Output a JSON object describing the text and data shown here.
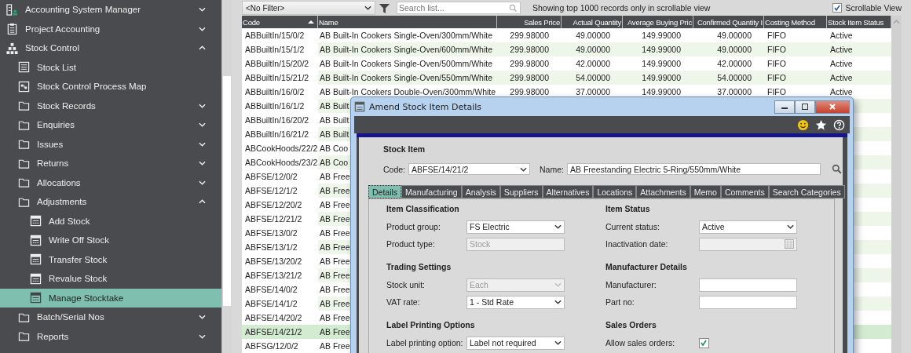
{
  "sidebar": {
    "items": [
      {
        "label": "Accounting System Manager",
        "kind": "users",
        "expanded": false
      },
      {
        "label": "Project Accounting",
        "kind": "clipboard",
        "expanded": false
      },
      {
        "label": "Stock Control",
        "kind": "sitemap",
        "expanded": true,
        "children": [
          {
            "label": "Stock List",
            "kind": "list"
          },
          {
            "label": "Stock Control Process Map",
            "kind": "process-map"
          },
          {
            "label": "Stock Records",
            "kind": "folder",
            "expanded": false
          },
          {
            "label": "Enquiries",
            "kind": "folder",
            "expanded": false
          },
          {
            "label": "Issues",
            "kind": "folder",
            "expanded": false
          },
          {
            "label": "Returns",
            "kind": "folder",
            "expanded": false
          },
          {
            "label": "Allocations",
            "kind": "folder",
            "expanded": false
          },
          {
            "label": "Adjustments",
            "kind": "folder",
            "expanded": true,
            "children": [
              {
                "label": "Add Stock",
                "kind": "form",
                "selected": false
              },
              {
                "label": "Write Off Stock",
                "kind": "form",
                "selected": false
              },
              {
                "label": "Transfer Stock",
                "kind": "form",
                "selected": false
              },
              {
                "label": "Revalue Stock",
                "kind": "form",
                "selected": false
              },
              {
                "label": "Manage Stocktake",
                "kind": "form",
                "selected": true
              }
            ]
          },
          {
            "label": "Batch/Serial Nos",
            "kind": "folder",
            "expanded": false
          },
          {
            "label": "Reports",
            "kind": "folder",
            "expanded": false
          }
        ]
      }
    ]
  },
  "toolbar": {
    "filter": "<No Filter>",
    "search": {
      "placeholder": "Search list..."
    },
    "notice": "Showing top 1000 records only in scrollable view",
    "scrollable_view": {
      "label": "Scrollable View",
      "checked": true
    }
  },
  "table": {
    "columns": [
      {
        "label": "Code",
        "sorted": true
      },
      {
        "label": "Name",
        "sorted": false
      },
      {
        "label": "Sales Price",
        "sorted": false
      },
      {
        "label": "Actual Quantity",
        "sorted": false
      },
      {
        "label": "Average Buying Pric",
        "sorted": false
      },
      {
        "label": "Confirmed Quantity I",
        "sorted": false
      },
      {
        "label": "Costing Method",
        "sorted": false
      },
      {
        "label": "Stock Item Status",
        "sorted": false
      }
    ],
    "rows": [
      {
        "selected": false,
        "cells": [
          "ABBuiltIn/15/0/2",
          "AB Built-In Cookers Single-Oven/300mm/White",
          "299.98000",
          "49.00000",
          "149.99000",
          "49.00000",
          "FIFO",
          "Active"
        ]
      },
      {
        "selected": false,
        "cells": [
          "ABBuiltIn/15/1/2",
          "AB Built-In Cookers Single-Oven/600mm/White",
          "299.98000",
          "49.00000",
          "149.99000",
          "49.00000",
          "FIFO",
          "Active"
        ]
      },
      {
        "selected": false,
        "cells": [
          "ABBuiltIn/15/20/2",
          "AB Built-In Cookers Single-Oven/500mm/White",
          "299.98000",
          "42.00000",
          "149.99000",
          "42.00000",
          "FIFO",
          "Active"
        ]
      },
      {
        "selected": false,
        "cells": [
          "ABBuiltIn/15/21/2",
          "AB Built-In Cookers Single-Oven/550mm/White",
          "299.98000",
          "54.00000",
          "149.99000",
          "54.00000",
          "FIFO",
          "Active"
        ]
      },
      {
        "selected": false,
        "cells": [
          "ABBuiltIn/16/0/2",
          "AB Built-In Cookers Double-Oven/300mm/White",
          "299.98000",
          "37.00000",
          "149.99000",
          "37.00000",
          "FIFO",
          "Active"
        ]
      },
      {
        "selected": false,
        "cells": [
          "ABBuiltIn/16/1/2",
          "AB Built"
        ]
      },
      {
        "selected": false,
        "cells": [
          "ABBuiltIn/16/20/2",
          "AB Built"
        ]
      },
      {
        "selected": false,
        "cells": [
          "ABBuiltIn/16/21/2",
          "AB Built"
        ]
      },
      {
        "selected": false,
        "cells": [
          "ABCookHoods/22/2",
          "AB Coo"
        ]
      },
      {
        "selected": false,
        "cells": [
          "ABCookHoods/23/2",
          "AB Coo"
        ]
      },
      {
        "selected": false,
        "cells": [
          "ABFSE/12/0/2",
          "AB Free"
        ]
      },
      {
        "selected": false,
        "cells": [
          "ABFSE/12/1/2",
          "AB Free"
        ]
      },
      {
        "selected": false,
        "cells": [
          "ABFSE/12/20/2",
          "AB Free"
        ]
      },
      {
        "selected": false,
        "cells": [
          "ABFSE/12/21/2",
          "AB Free"
        ]
      },
      {
        "selected": false,
        "cells": [
          "ABFSE/13/0/2",
          "AB Free"
        ]
      },
      {
        "selected": false,
        "cells": [
          "ABFSE/13/1/2",
          "AB Free"
        ]
      },
      {
        "selected": false,
        "cells": [
          "ABFSE/13/20/2",
          "AB Free"
        ]
      },
      {
        "selected": false,
        "cells": [
          "ABFSE/13/21/2",
          "AB Free"
        ]
      },
      {
        "selected": false,
        "cells": [
          "ABFSE/14/0/2",
          "AB Free"
        ]
      },
      {
        "selected": false,
        "cells": [
          "ABFSE/14/1/2",
          "AB Free"
        ]
      },
      {
        "selected": false,
        "cells": [
          "ABFSE/14/20/2",
          "AB Free"
        ]
      },
      {
        "selected": true,
        "cells": [
          "ABFSE/14/21/2",
          "AB Free"
        ]
      },
      {
        "selected": false,
        "cells": [
          "ABFSG/12/0/2",
          "AB Free"
        ]
      }
    ]
  },
  "dialog": {
    "title": "Amend Stock Item Details",
    "section": "Stock Item",
    "code": {
      "label": "Code:",
      "value": "ABFSE/14/21/2"
    },
    "name": {
      "label": "Name:",
      "value": "AB Freestanding Electric 5-Ring/550mm/White"
    },
    "tabs": [
      {
        "label": "Details",
        "selected": true
      },
      {
        "label": "Manufacturing",
        "selected": false
      },
      {
        "label": "Analysis",
        "selected": false
      },
      {
        "label": "Suppliers",
        "selected": false
      },
      {
        "label": "Alternatives",
        "selected": false
      },
      {
        "label": "Locations",
        "selected": false
      },
      {
        "label": "Attachments",
        "selected": false
      },
      {
        "label": "Memo",
        "selected": false
      },
      {
        "label": "Comments",
        "selected": false
      },
      {
        "label": "Search Categories",
        "selected": false
      }
    ],
    "columns": [
      [
        {
          "title": "Item Classification",
          "fields": [
            {
              "label": "Product group:",
              "kind": "select",
              "value": "FS Electric",
              "disabled": false
            },
            {
              "label": "Product type:",
              "kind": "text",
              "value": "Stock",
              "disabled": true
            }
          ]
        },
        {
          "title": "Trading Settings",
          "fields": [
            {
              "label": "Stock unit:",
              "kind": "select",
              "value": "Each",
              "disabled": true
            },
            {
              "label": "VAT rate:",
              "kind": "select",
              "value": "1 - Std Rate",
              "disabled": false
            }
          ]
        },
        {
          "title": "Label Printing Options",
          "fields": [
            {
              "label": "Label printing option:",
              "kind": "select",
              "value": "Label not required",
              "disabled": false
            }
          ]
        }
      ],
      [
        {
          "title": "Item Status",
          "fields": [
            {
              "label": "Current status:",
              "kind": "select",
              "value": "Active",
              "disabled": false
            },
            {
              "label": "Inactivation date:",
              "kind": "date",
              "disabled": true
            }
          ]
        },
        {
          "title": "Manufacturer Details",
          "fields": [
            {
              "label": "Manufacturer:",
              "kind": "text",
              "disabled": false
            },
            {
              "label": "Part no:",
              "kind": "text",
              "disabled": false
            }
          ]
        },
        {
          "title": "Sales Orders",
          "fields": [
            {
              "label": "Allow sales orders:",
              "kind": "checkbox",
              "checked": true,
              "disabled": false
            }
          ]
        }
      ]
    ]
  }
}
